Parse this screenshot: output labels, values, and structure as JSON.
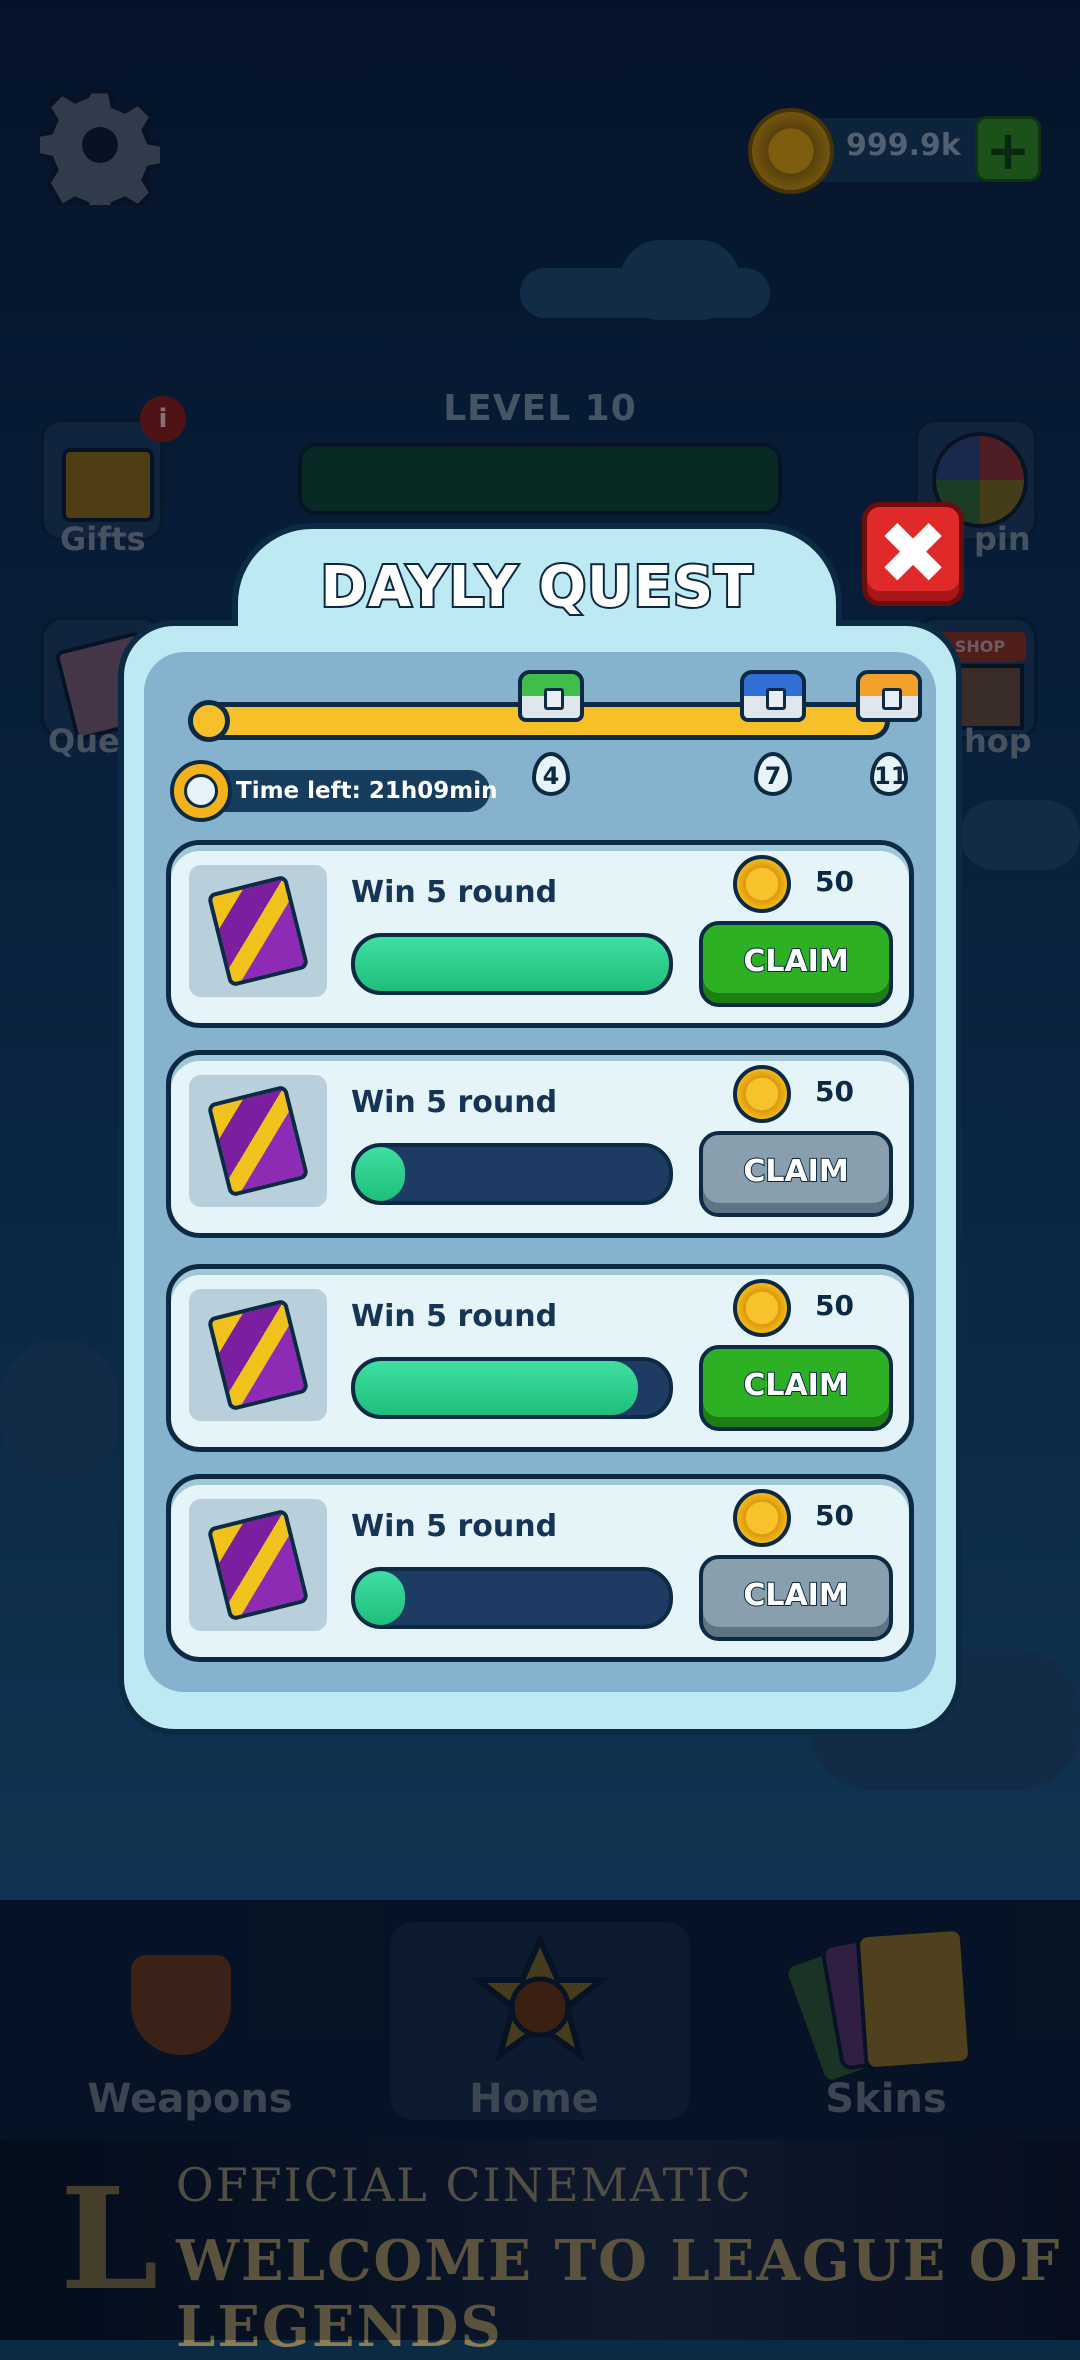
{
  "hud": {
    "coin_amount": "999.9k",
    "add_icon": "plus-icon",
    "settings_icon": "gear-icon"
  },
  "level": {
    "label": "LEVEL 10"
  },
  "side": {
    "gifts": "Gifts",
    "gifts_badge": "i",
    "quests": "Que",
    "spin": "pin",
    "shop": "hop",
    "shop_sign": "SHOP"
  },
  "modal": {
    "title": "DAYLY QUEST",
    "close_icon": "close-icon",
    "timer": "Time left: 21h09min",
    "milestones": [
      {
        "label": "4",
        "chest": "green-chest-icon",
        "color": "#3fbf4a"
      },
      {
        "label": "7",
        "chest": "blue-chest-icon",
        "color": "#2f6fd6"
      },
      {
        "label": "11",
        "chest": "orange-chest-icon",
        "color": "#f2a22a"
      }
    ],
    "track_progress": 1.0,
    "quests": [
      {
        "title": "Win 5 round",
        "reward": "50",
        "progress": 1.0,
        "claim": "CLAIM",
        "enabled": true
      },
      {
        "title": "Win 5 round",
        "reward": "50",
        "progress": 0.1,
        "claim": "CLAIM",
        "enabled": false
      },
      {
        "title": "Win 5 round",
        "reward": "50",
        "progress": 0.9,
        "claim": "CLAIM",
        "enabled": true
      },
      {
        "title": "Win 5 round",
        "reward": "50",
        "progress": 0.1,
        "claim": "CLAIM",
        "enabled": false
      }
    ]
  },
  "nav": {
    "weapons": "Weapons",
    "home": "Home",
    "skins": "Skins"
  },
  "banner": {
    "line1": "OFFICIAL CINEMATIC",
    "line2": "WELCOME TO LEAGUE OF LEGENDS",
    "logo": "L"
  }
}
